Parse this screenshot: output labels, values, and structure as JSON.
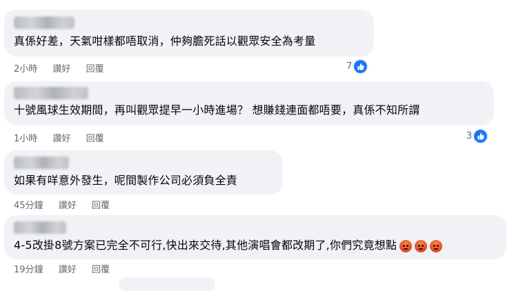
{
  "comments": [
    {
      "text": "真係好差，天氣咁樣都唔取消，仲夠膽死話以觀眾安全為考量",
      "time": "2小時",
      "like_label": "讚好",
      "reply_label": "回覆",
      "reaction_count": "7",
      "reaction_type": "like"
    },
    {
      "text": "十號風球生效期間，再叫觀眾提早一小時進場？ 想賺錢連面都唔要，真係不知所謂",
      "time": "1小時",
      "like_label": "讚好",
      "reply_label": "回覆",
      "reaction_count": "3",
      "reaction_type": "like"
    },
    {
      "text": "如果有咩意外發生，呢間製作公司必須負全責",
      "time": "45分鐘",
      "like_label": "讚好",
      "reply_label": "回覆",
      "reaction_count": "",
      "reaction_type": ""
    },
    {
      "text": "4-5改掛8號方案已完全不可行,快出來交待,其他演唱會都改期了,你們究竟想點",
      "time": "19分鐘",
      "like_label": "讚好",
      "reply_label": "回覆",
      "reaction_count": "",
      "reaction_type": "",
      "emoji": [
        "angry-face",
        "angry-face",
        "angry-face"
      ]
    }
  ],
  "colors": {
    "bubble": "#f0f2f5",
    "like_blue": "#1877f2",
    "meta_gray": "#65676b",
    "text": "#050505"
  }
}
